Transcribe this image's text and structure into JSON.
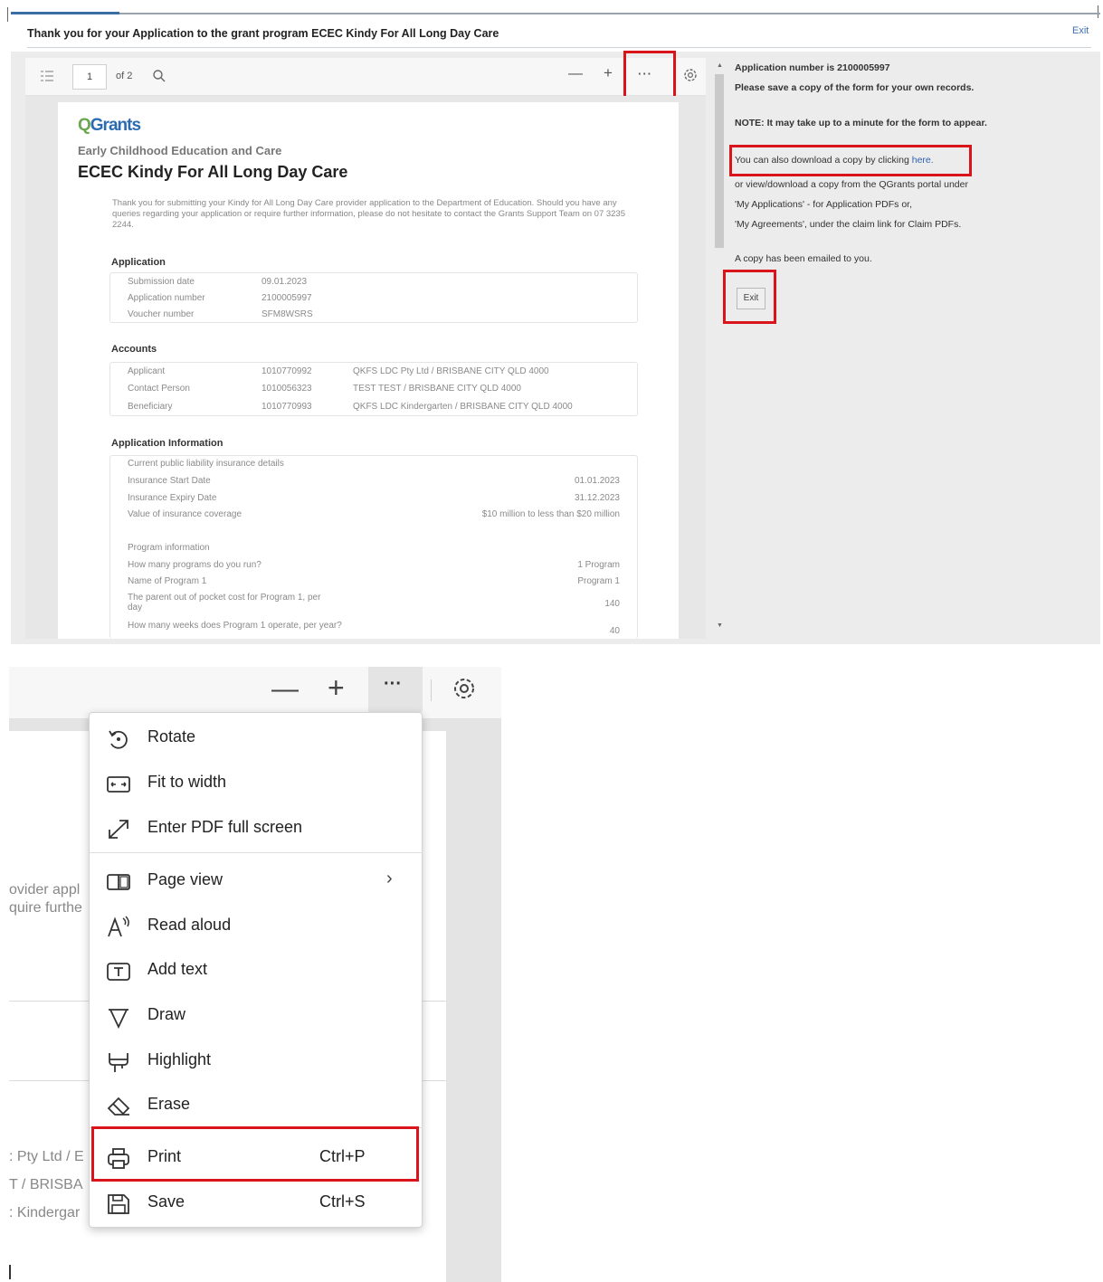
{
  "header": {
    "title": "Thank you for your Application to the grant program ECEC Kindy For All Long Day Care",
    "exit_label": "Exit"
  },
  "viewer_toolbar": {
    "page_current": "1",
    "page_total": "of 2",
    "minus": "—",
    "plus": "+",
    "more": "···"
  },
  "document": {
    "logo_q": "Q",
    "logo_rest": "Grants",
    "subtitle": "Early Childhood Education and Care",
    "title": "ECEC Kindy For All Long Day Care",
    "intro": "Thank you for submitting your Kindy for All Long Day Care provider application to the Department of Education. Should you have any queries regarding your application or require further information, please do not hesitate to contact the Grants Support Team on 07 3235 2244.",
    "application": {
      "title": "Application",
      "rows": [
        {
          "label": "Submission date",
          "value": "09.01.2023"
        },
        {
          "label": "Application number",
          "value": "2100005997"
        },
        {
          "label": "Voucher number",
          "value": "SFM8WSRS"
        }
      ]
    },
    "accounts": {
      "title": "Accounts",
      "rows": [
        {
          "label": "Applicant",
          "id": "1010770992",
          "name": "QKFS LDC Pty Ltd / BRISBANE CITY QLD 4000"
        },
        {
          "label": "Contact Person",
          "id": "1010056323",
          "name": "TEST TEST / BRISBANE CITY QLD 4000"
        },
        {
          "label": "Beneficiary",
          "id": "1010770993",
          "name": "QKFS LDC Kindergarten / BRISBANE CITY QLD 4000"
        }
      ]
    },
    "app_info": {
      "title": "Application Information",
      "insurance_heading": "Current public liability insurance details",
      "insurance_rows": [
        {
          "label": "Insurance Start Date",
          "value": "01.01.2023"
        },
        {
          "label": "Insurance Expiry Date",
          "value": "31.12.2023"
        },
        {
          "label": "Value of insurance coverage",
          "value": "$10 million to less than $20 million"
        }
      ],
      "program_heading": "Program information",
      "program_rows": [
        {
          "label": "How many programs do you run?",
          "value": "1 Program"
        },
        {
          "label": "Name of Program 1",
          "value": "Program 1"
        },
        {
          "label": "The parent out of pocket cost for Program 1, per day",
          "value": "140"
        },
        {
          "label": "How many weeks does Program 1 operate, per year?",
          "value": "40"
        }
      ]
    }
  },
  "side_panel": {
    "line1": "Application number is 2100005997",
    "line2": "Please save a copy of the form for your own records.",
    "line3": "NOTE: It may take up to a minute for the form to appear.",
    "line4_prefix": "You can also download a copy by clicking ",
    "line4_link": "here.",
    "line5": "or view/download a copy from the QGrants portal under",
    "line6": "'My Applications' - for Application PDFs or,",
    "line7": "'My Agreements', under the claim link for Claim PDFs.",
    "line8": "A copy has been emailed to you.",
    "exit_button": "Exit"
  },
  "zoom_toolbar": {
    "minus": "—",
    "plus": "+",
    "more": "···"
  },
  "zoom_background_text": {
    "t1": "ovider appl",
    "t2": "quire furthe",
    "t3": ": Pty Ltd / E",
    "t4": "T / BRISBA",
    "t5": ": Kindergar"
  },
  "menu": {
    "items": [
      {
        "label": "Rotate",
        "icon": "rotate-icon"
      },
      {
        "label": "Fit to width",
        "icon": "fit-width-icon"
      },
      {
        "label": "Enter PDF full screen",
        "icon": "fullscreen-icon"
      },
      {
        "label": "Page view",
        "icon": "page-view-icon"
      },
      {
        "label": "Read aloud",
        "icon": "read-aloud-icon"
      },
      {
        "label": "Add text",
        "icon": "add-text-icon"
      },
      {
        "label": "Draw",
        "icon": "draw-icon"
      },
      {
        "label": "Highlight",
        "icon": "highlight-icon"
      },
      {
        "label": "Erase",
        "icon": "erase-icon"
      },
      {
        "label": "Print",
        "shortcut": "Ctrl+P",
        "icon": "print-icon"
      },
      {
        "label": "Save",
        "shortcut": "Ctrl+S",
        "icon": "save-icon"
      }
    ],
    "page_view_chevron": "›"
  },
  "colors": {
    "highlight": "#d9141b",
    "link": "#2f5fb3",
    "logo_q": "#6aa84f",
    "logo_text": "#2b6cb0"
  }
}
